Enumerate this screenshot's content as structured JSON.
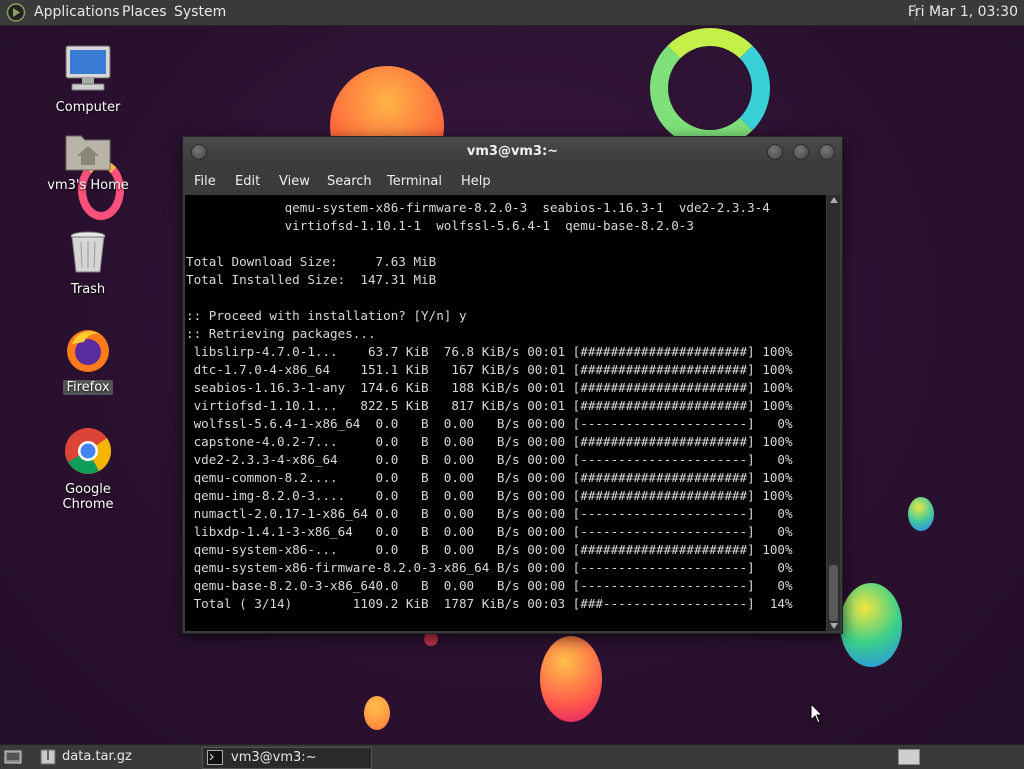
{
  "top_panel": {
    "menus": [
      "Applications",
      "Places",
      "System"
    ],
    "clock": "Fri Mar 1, 03:30"
  },
  "desktop_icons": [
    {
      "label": "Computer",
      "icon": "computer-icon"
    },
    {
      "label": "vm3's Home",
      "icon": "home-folder-icon"
    },
    {
      "label": "Trash",
      "icon": "trash-icon"
    },
    {
      "label": "Firefox",
      "icon": "firefox-icon"
    },
    {
      "label": "Google Chrome",
      "icon": "chrome-icon"
    }
  ],
  "terminal": {
    "title": "vm3@vm3:~",
    "menu": [
      "File",
      "Edit",
      "View",
      "Search",
      "Terminal",
      "Help"
    ],
    "lines": [
      "             qemu-system-x86-firmware-8.2.0-3  seabios-1.16.3-1  vde2-2.3.3-4",
      "             virtiofsd-1.10.1-1  wolfssl-5.6.4-1  qemu-base-8.2.0-3",
      "",
      "Total Download Size:     7.63 MiB",
      "Total Installed Size:  147.31 MiB",
      "",
      ":: Proceed with installation? [Y/n] y",
      ":: Retrieving packages...",
      " libslirp-4.7.0-1...    63.7 KiB  76.8 KiB/s 00:01 [######################] 100%",
      " dtc-1.7.0-4-x86_64    151.1 KiB   167 KiB/s 00:01 [######################] 100%",
      " seabios-1.16.3-1-any  174.6 KiB   188 KiB/s 00:01 [######################] 100%",
      " virtiofsd-1.10.1...   822.5 KiB   817 KiB/s 00:01 [######################] 100%",
      " wolfssl-5.6.4-1-x86_64  0.0   B  0.00   B/s 00:00 [----------------------]   0%",
      " capstone-4.0.2-7...     0.0   B  0.00   B/s 00:00 [######################] 100%",
      " vde2-2.3.3-4-x86_64     0.0   B  0.00   B/s 00:00 [----------------------]   0%",
      " qemu-common-8.2....     0.0   B  0.00   B/s 00:00 [######################] 100%",
      " qemu-img-8.2.0-3....    0.0   B  0.00   B/s 00:00 [######################] 100%",
      " numactl-2.0.17-1-x86_64 0.0   B  0.00   B/s 00:00 [----------------------]   0%",
      " libxdp-1.4.1-3-x86_64   0.0   B  0.00   B/s 00:00 [----------------------]   0%",
      " qemu-system-x86-...     0.0   B  0.00   B/s 00:00 [######################] 100%",
      " qemu-system-x86-firmware-8.2.0-3-x86_64 B/s 00:00 [----------------------]   0%",
      " qemu-base-8.2.0-3-x86_640.0   B  0.00   B/s 00:00 [----------------------]   0%",
      " Total ( 3/14)        1109.2 KiB  1787 KiB/s 00:03 [###-------------------]  14%"
    ]
  },
  "taskbar": {
    "items": [
      {
        "label": "data.tar.gz",
        "icon": "archive-icon"
      },
      {
        "label": "vm3@vm3:~",
        "icon": "terminal-icon"
      }
    ]
  },
  "colors": {
    "panel": "#3a3a3a",
    "terminal_bg": "#000000",
    "terminal_fg": "#d8d8d8",
    "desktop_bg": "#2b1130"
  }
}
